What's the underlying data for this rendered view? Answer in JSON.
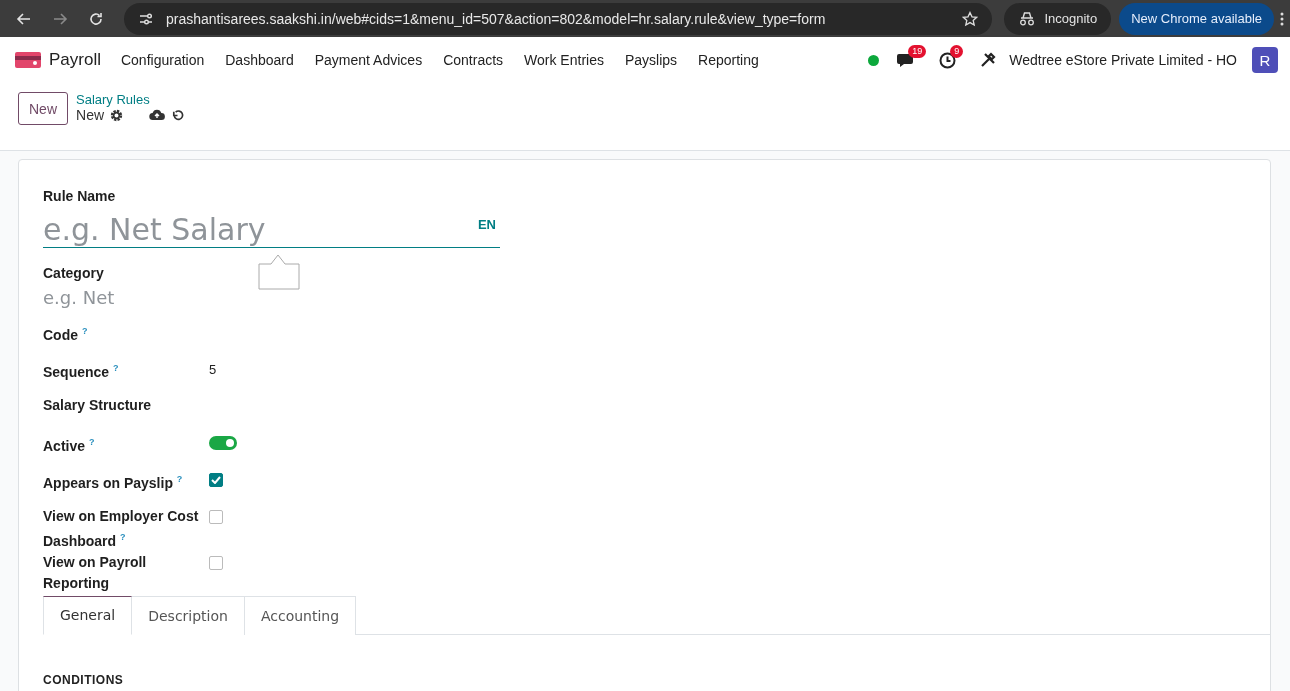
{
  "browser": {
    "url": "prashantisarees.saakshi.in/web#cids=1&menu_id=507&action=802&model=hr.salary.rule&view_type=form",
    "incognito_label": "Incognito",
    "update_button": "New Chrome available"
  },
  "navbar": {
    "app_name": "Payroll",
    "menu": [
      "Configuration",
      "Dashboard",
      "Payment Advices",
      "Contracts",
      "Work Entries",
      "Payslips",
      "Reporting"
    ],
    "messages_count": "19",
    "activities_count": "9",
    "company": "Wedtree eStore Private Limited - HO",
    "avatar_letter": "R"
  },
  "control_panel": {
    "new_button": "New",
    "breadcrumb": "Salary Rules",
    "record_name": "New"
  },
  "form": {
    "name_label": "Rule Name",
    "name_placeholder": "e.g. Net Salary",
    "language": "EN",
    "fields": [
      {
        "kind": "placeholder",
        "label": "Category",
        "placeholder": "e.g. Net"
      },
      {
        "kind": "text",
        "label": "Code $^{?}$"
      },
      {
        "kind": "text",
        "label": "Sequence $^{?}$",
        "value": "5"
      },
      {
        "kind": "text",
        "label": "Salary Structure"
      },
      {
        "kind": "toggle",
        "label": "Active $^{?}$",
        "on": true
      },
      {
        "kind": "checkbox",
        "label": "Appears on Payslip $^{?}$",
        "checked": true
      },
      {
        "kind": "checkbox",
        "label": "View on Employer Cost Dashboard $^{?}$",
        "checked": false
      },
      {
        "kind": "checkbox",
        "label": "View on Payroll Reporting",
        "checked": false
      }
    ],
    "tabs": [
      {
        "label": "General",
        "selected": true
      },
      {
        "label": "Description",
        "selected": false
      },
      {
        "label": "Accounting",
        "selected": false
      }
    ],
    "section_title": "CONDITIONS"
  }
}
